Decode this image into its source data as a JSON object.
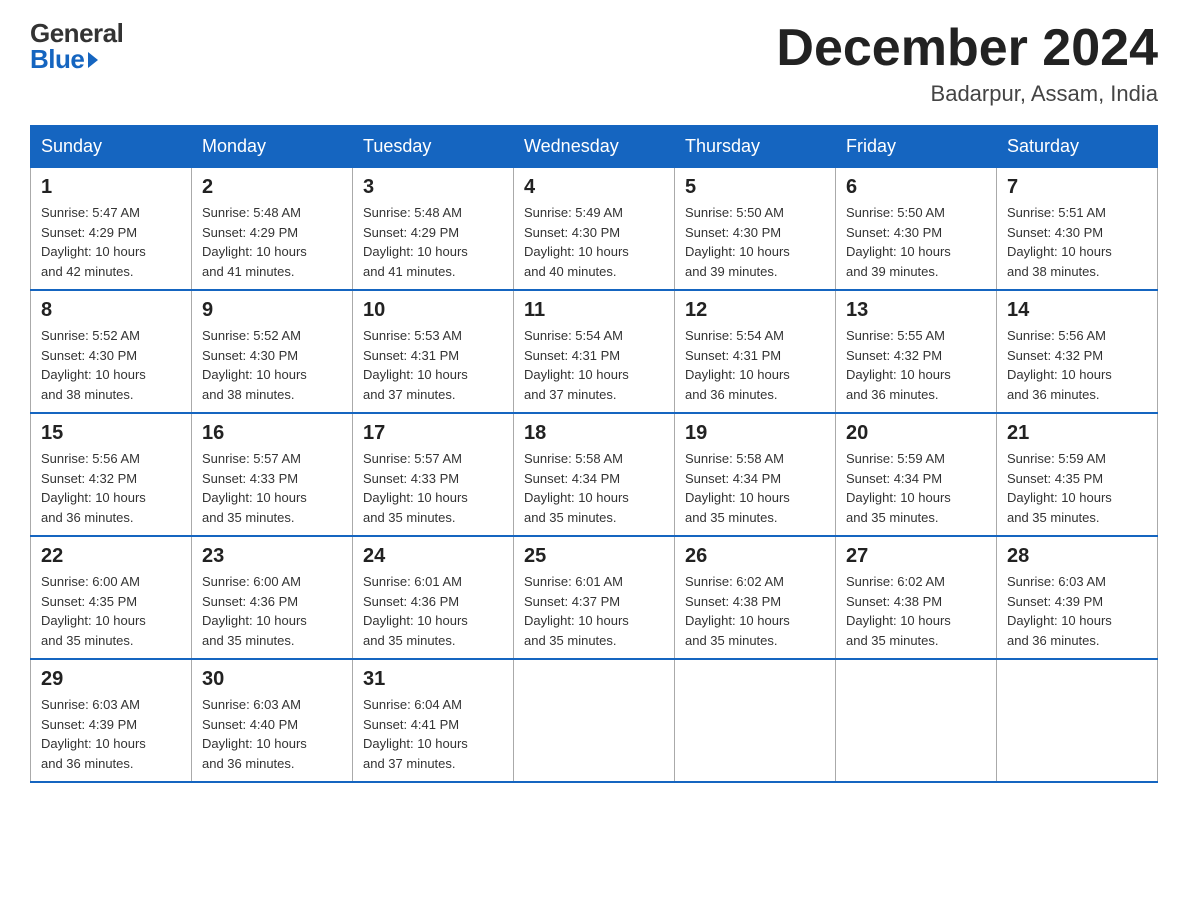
{
  "logo": {
    "general": "General",
    "blue": "Blue"
  },
  "header": {
    "month": "December 2024",
    "location": "Badarpur, Assam, India"
  },
  "days_of_week": [
    "Sunday",
    "Monday",
    "Tuesday",
    "Wednesday",
    "Thursday",
    "Friday",
    "Saturday"
  ],
  "weeks": [
    [
      {
        "num": "1",
        "sunrise": "5:47 AM",
        "sunset": "4:29 PM",
        "daylight": "10 hours and 42 minutes."
      },
      {
        "num": "2",
        "sunrise": "5:48 AM",
        "sunset": "4:29 PM",
        "daylight": "10 hours and 41 minutes."
      },
      {
        "num": "3",
        "sunrise": "5:48 AM",
        "sunset": "4:29 PM",
        "daylight": "10 hours and 41 minutes."
      },
      {
        "num": "4",
        "sunrise": "5:49 AM",
        "sunset": "4:30 PM",
        "daylight": "10 hours and 40 minutes."
      },
      {
        "num": "5",
        "sunrise": "5:50 AM",
        "sunset": "4:30 PM",
        "daylight": "10 hours and 39 minutes."
      },
      {
        "num": "6",
        "sunrise": "5:50 AM",
        "sunset": "4:30 PM",
        "daylight": "10 hours and 39 minutes."
      },
      {
        "num": "7",
        "sunrise": "5:51 AM",
        "sunset": "4:30 PM",
        "daylight": "10 hours and 38 minutes."
      }
    ],
    [
      {
        "num": "8",
        "sunrise": "5:52 AM",
        "sunset": "4:30 PM",
        "daylight": "10 hours and 38 minutes."
      },
      {
        "num": "9",
        "sunrise": "5:52 AM",
        "sunset": "4:30 PM",
        "daylight": "10 hours and 38 minutes."
      },
      {
        "num": "10",
        "sunrise": "5:53 AM",
        "sunset": "4:31 PM",
        "daylight": "10 hours and 37 minutes."
      },
      {
        "num": "11",
        "sunrise": "5:54 AM",
        "sunset": "4:31 PM",
        "daylight": "10 hours and 37 minutes."
      },
      {
        "num": "12",
        "sunrise": "5:54 AM",
        "sunset": "4:31 PM",
        "daylight": "10 hours and 36 minutes."
      },
      {
        "num": "13",
        "sunrise": "5:55 AM",
        "sunset": "4:32 PM",
        "daylight": "10 hours and 36 minutes."
      },
      {
        "num": "14",
        "sunrise": "5:56 AM",
        "sunset": "4:32 PM",
        "daylight": "10 hours and 36 minutes."
      }
    ],
    [
      {
        "num": "15",
        "sunrise": "5:56 AM",
        "sunset": "4:32 PM",
        "daylight": "10 hours and 36 minutes."
      },
      {
        "num": "16",
        "sunrise": "5:57 AM",
        "sunset": "4:33 PM",
        "daylight": "10 hours and 35 minutes."
      },
      {
        "num": "17",
        "sunrise": "5:57 AM",
        "sunset": "4:33 PM",
        "daylight": "10 hours and 35 minutes."
      },
      {
        "num": "18",
        "sunrise": "5:58 AM",
        "sunset": "4:34 PM",
        "daylight": "10 hours and 35 minutes."
      },
      {
        "num": "19",
        "sunrise": "5:58 AM",
        "sunset": "4:34 PM",
        "daylight": "10 hours and 35 minutes."
      },
      {
        "num": "20",
        "sunrise": "5:59 AM",
        "sunset": "4:34 PM",
        "daylight": "10 hours and 35 minutes."
      },
      {
        "num": "21",
        "sunrise": "5:59 AM",
        "sunset": "4:35 PM",
        "daylight": "10 hours and 35 minutes."
      }
    ],
    [
      {
        "num": "22",
        "sunrise": "6:00 AM",
        "sunset": "4:35 PM",
        "daylight": "10 hours and 35 minutes."
      },
      {
        "num": "23",
        "sunrise": "6:00 AM",
        "sunset": "4:36 PM",
        "daylight": "10 hours and 35 minutes."
      },
      {
        "num": "24",
        "sunrise": "6:01 AM",
        "sunset": "4:36 PM",
        "daylight": "10 hours and 35 minutes."
      },
      {
        "num": "25",
        "sunrise": "6:01 AM",
        "sunset": "4:37 PM",
        "daylight": "10 hours and 35 minutes."
      },
      {
        "num": "26",
        "sunrise": "6:02 AM",
        "sunset": "4:38 PM",
        "daylight": "10 hours and 35 minutes."
      },
      {
        "num": "27",
        "sunrise": "6:02 AM",
        "sunset": "4:38 PM",
        "daylight": "10 hours and 35 minutes."
      },
      {
        "num": "28",
        "sunrise": "6:03 AM",
        "sunset": "4:39 PM",
        "daylight": "10 hours and 36 minutes."
      }
    ],
    [
      {
        "num": "29",
        "sunrise": "6:03 AM",
        "sunset": "4:39 PM",
        "daylight": "10 hours and 36 minutes."
      },
      {
        "num": "30",
        "sunrise": "6:03 AM",
        "sunset": "4:40 PM",
        "daylight": "10 hours and 36 minutes."
      },
      {
        "num": "31",
        "sunrise": "6:04 AM",
        "sunset": "4:41 PM",
        "daylight": "10 hours and 37 minutes."
      },
      null,
      null,
      null,
      null
    ]
  ],
  "labels": {
    "sunrise": "Sunrise:",
    "sunset": "Sunset:",
    "daylight": "Daylight:"
  }
}
